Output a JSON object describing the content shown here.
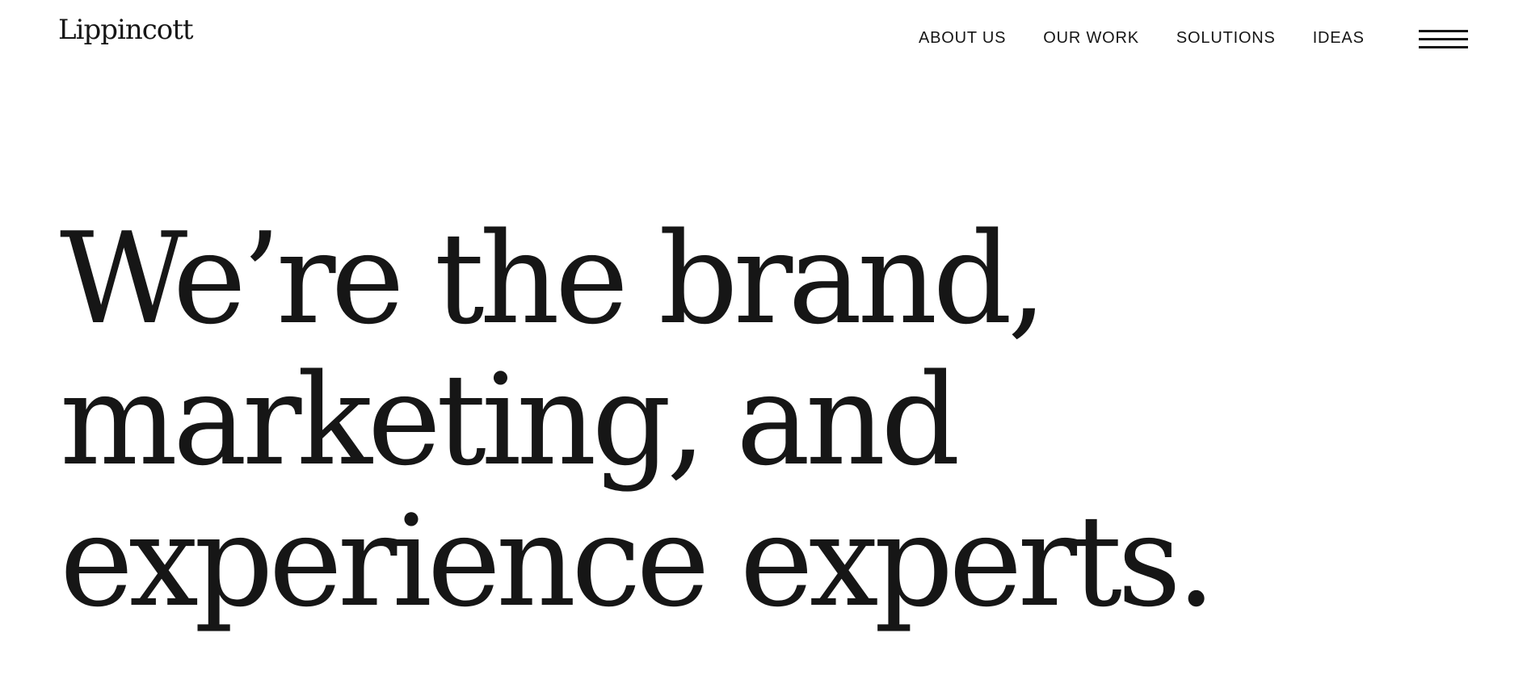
{
  "header": {
    "logo": "Lippincott",
    "nav": [
      {
        "label": "ABOUT US"
      },
      {
        "label": "OUR WORK"
      },
      {
        "label": "SOLUTIONS"
      },
      {
        "label": "IDEAS"
      }
    ],
    "menu_icon": "hamburger-menu-icon"
  },
  "hero": {
    "headline_lines": [
      "We’re the brand,",
      "marketing, and",
      "experience experts."
    ]
  }
}
